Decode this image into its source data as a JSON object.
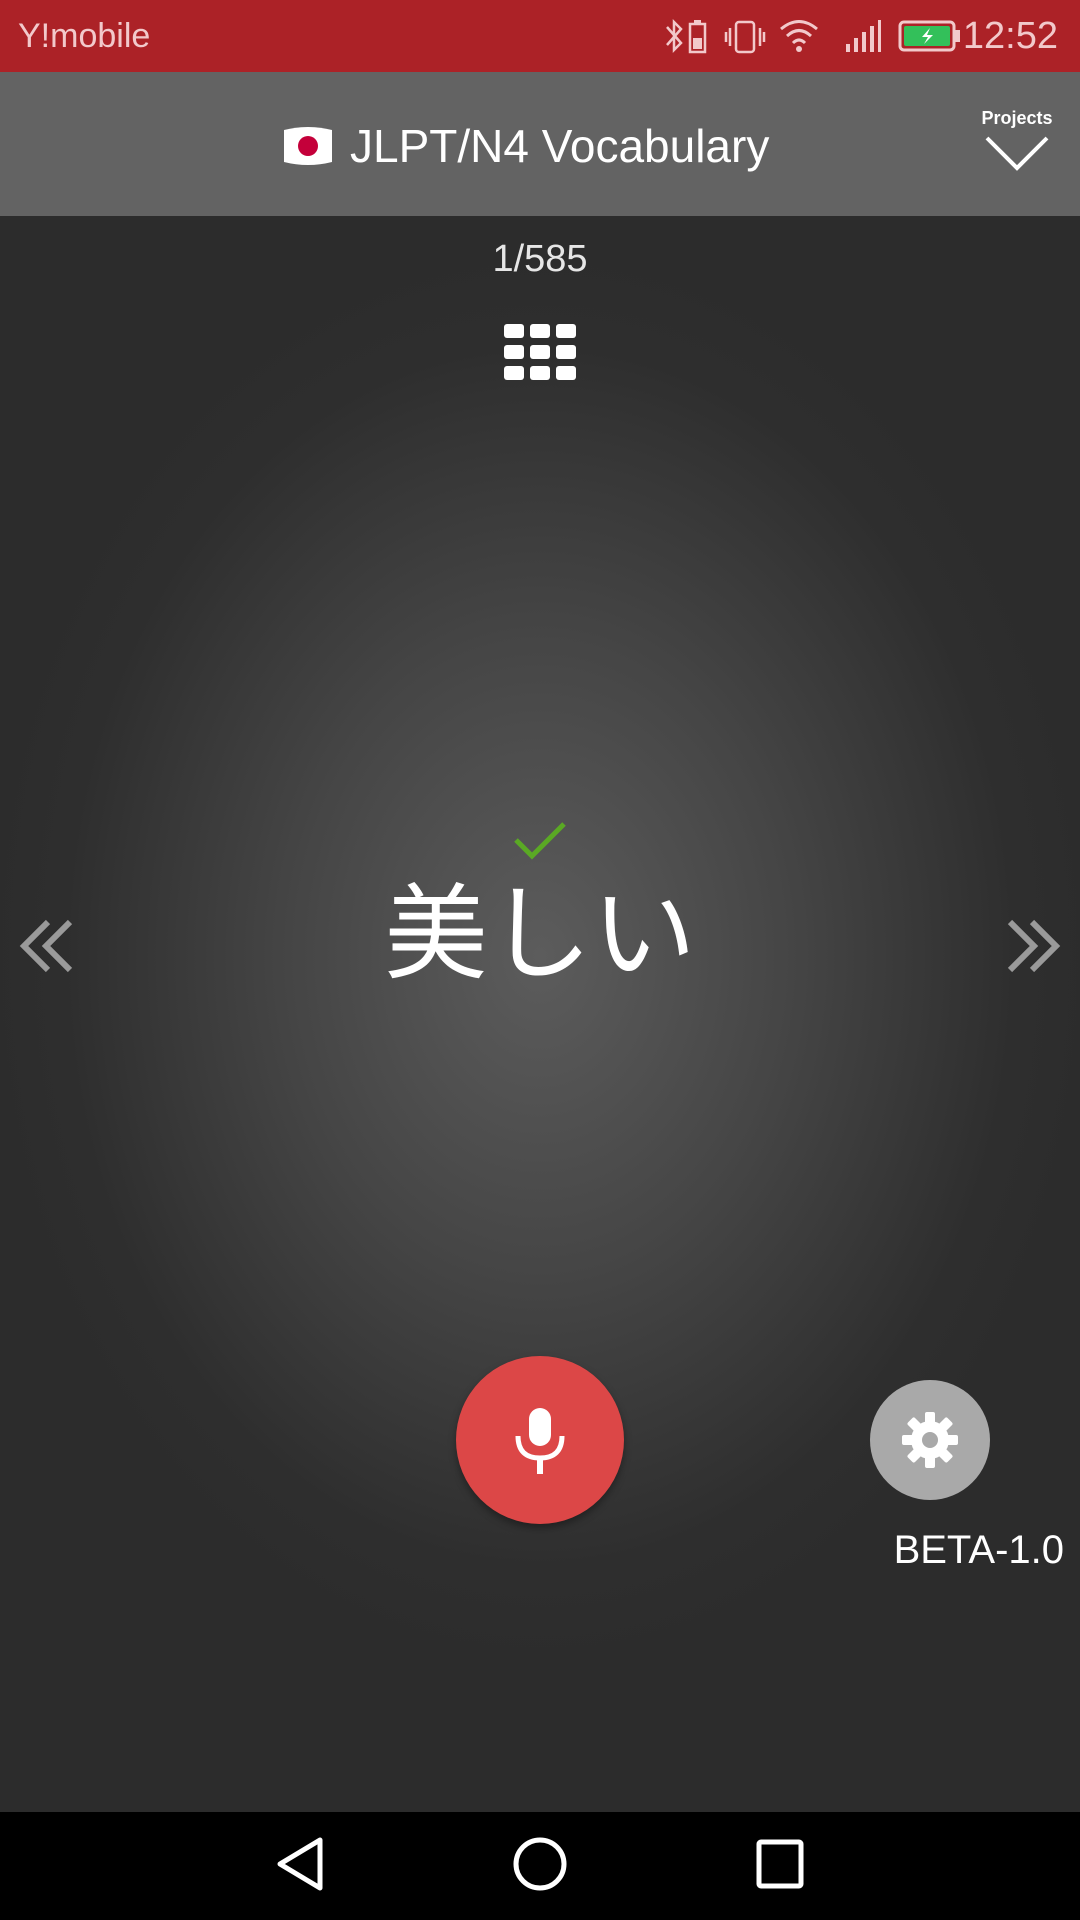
{
  "status_bar": {
    "carrier": "Y!mobile",
    "time": "12:52",
    "icons": [
      "bluetooth-icon",
      "vibrate-icon",
      "wifi-icon",
      "signal-icon",
      "battery-charging-icon"
    ]
  },
  "header": {
    "flag_icon": "japan-flag-icon",
    "title": "JLPT/N4 Vocabulary",
    "projects_label": "Projects"
  },
  "main": {
    "counter": "1/585",
    "word": "美しい",
    "check_color": "#5aa924",
    "grid_icon": "grid-icon",
    "prev_icon": "double-chevron-left-icon",
    "next_icon": "double-chevron-right-icon"
  },
  "actions": {
    "mic_color": "#dc4747",
    "settings_color": "#a9a9a9",
    "version": "BETA-1.0"
  },
  "colors": {
    "status_bar": "#ac2227",
    "header": "#636363",
    "background": "#2c2c2c"
  }
}
